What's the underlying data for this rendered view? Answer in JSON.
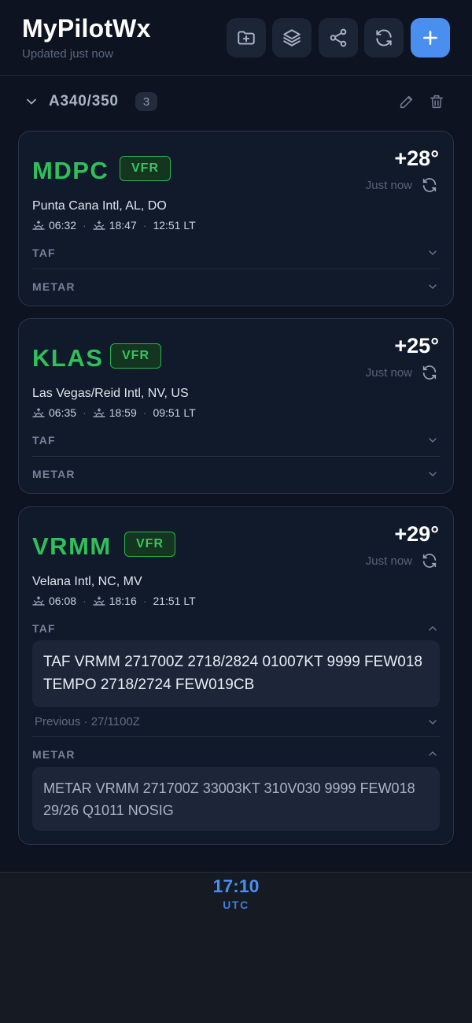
{
  "header": {
    "title": "MyPilotWx",
    "updated": "Updated just now",
    "buttons": [
      "folder-plus-icon",
      "layers-icon",
      "share-icon",
      "refresh-icon",
      "plus-icon"
    ]
  },
  "group": {
    "name": "A340/350",
    "count": "3"
  },
  "stations": [
    {
      "icao": "MDPC",
      "category": "VFR",
      "temp": "+28°",
      "updated": "Just now",
      "name": "Punta Cana Intl, AL, DO",
      "sunrise": "06:32",
      "sunset": "18:47",
      "local_time": "12:51 LT",
      "taf_label": "TAF",
      "metar_label": "METAR"
    },
    {
      "icao": "KLAS",
      "category": "VFR",
      "temp": "+25°",
      "updated": "Just now",
      "name": "Las Vegas/Reid Intl, NV, US",
      "sunrise": "06:35",
      "sunset": "18:59",
      "local_time": "09:51 LT",
      "taf_label": "TAF",
      "metar_label": "METAR"
    },
    {
      "icao": "VRMM",
      "category": "VFR",
      "temp": "+29°",
      "updated": "Just now",
      "name": "Velana Intl, NC, MV",
      "sunrise": "06:08",
      "sunset": "18:16",
      "local_time": "21:51 LT",
      "taf_label": "TAF",
      "metar_label": "METAR",
      "taf_raw": "TAF VRMM 271700Z 2718/2824 01007KT 9999 FEW018 TEMPO 2718/2724 FEW019CB",
      "taf_previous": "Previous · 27/1100Z",
      "metar_raw": "METAR VRMM 271700Z 33003KT 310V030 9999 FEW018 29/26 Q1011 NOSIG"
    }
  ],
  "footer": {
    "time": "17:10",
    "label": "UTC"
  },
  "colors": {
    "accent": "#4a8ff0",
    "vfr": "#2fc05a",
    "background": "#0d1320"
  }
}
